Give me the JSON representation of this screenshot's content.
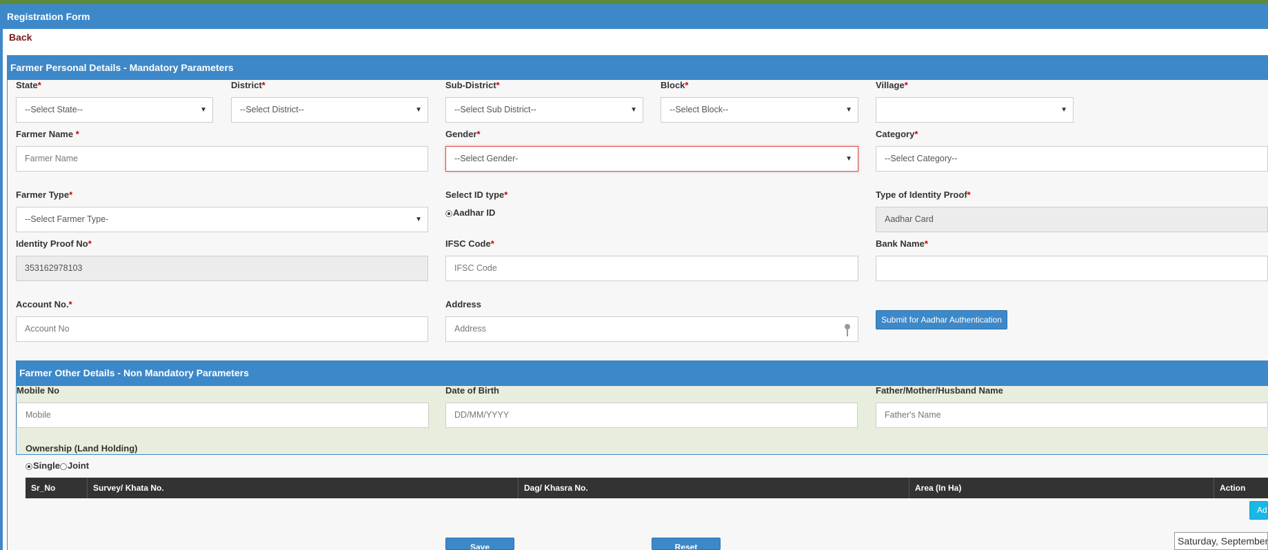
{
  "header": {
    "title": "Registration Form",
    "back_label": "Back"
  },
  "personal": {
    "section_title": "Farmer Personal Details - Mandatory Parameters",
    "state": {
      "label": "State",
      "value": "--Select State--"
    },
    "district": {
      "label": "District",
      "value": "--Select District--"
    },
    "sub_district": {
      "label": "Sub-District",
      "value": "--Select Sub District--"
    },
    "block": {
      "label": "Block",
      "value": "--Select Block--"
    },
    "village": {
      "label": "Village",
      "value": ""
    },
    "farmer_name": {
      "label": "Farmer Name ",
      "placeholder": "Farmer Name"
    },
    "gender": {
      "label": "Gender",
      "value": "--Select Gender-"
    },
    "category": {
      "label": "Category",
      "value": "--Select Category--"
    },
    "farmer_type": {
      "label": "Farmer Type",
      "value": "--Select Farmer Type-"
    },
    "id_type": {
      "label": "Select ID type",
      "option": "Aadhar ID"
    },
    "identity_proof_type": {
      "label": "Type of Identity Proof",
      "value": "Aadhar Card"
    },
    "identity_proof_no": {
      "label": "Identity Proof No",
      "value": "353162978103"
    },
    "ifsc": {
      "label": "IFSC Code",
      "placeholder": "IFSC Code"
    },
    "bank_name": {
      "label": "Bank Name",
      "value": ""
    },
    "account_no": {
      "label": "Account No.",
      "placeholder": "Account No"
    },
    "address": {
      "label": "Address",
      "placeholder": "Address"
    },
    "submit_label": "Submit for Aadhar Authentication"
  },
  "other": {
    "section_title": "Farmer Other Details - Non Mandatory Parameters",
    "mobile": {
      "label": "Mobile No",
      "placeholder": "Mobile"
    },
    "dob": {
      "label": "Date of Birth",
      "placeholder": "DD/MM/YYYY"
    },
    "relative": {
      "label": "Father/Mother/Husband Name",
      "placeholder": "Father's Name"
    }
  },
  "ownership": {
    "label": "Ownership (Land Holding)",
    "options": [
      "Single",
      "Joint"
    ],
    "selected": "Single"
  },
  "land_table": {
    "columns": [
      "Sr_No",
      "Survey/ Khata No.",
      "Dag/ Khasra No.",
      "Area (In Ha)",
      "Action"
    ],
    "add_label": "Add"
  },
  "footer": {
    "save_label": "Save",
    "reset_label": "Reset",
    "date_text": "Saturday, September"
  },
  "colors": {
    "header_blue": "#3d88c8",
    "required": "#cc0000",
    "table_head": "#333333"
  }
}
